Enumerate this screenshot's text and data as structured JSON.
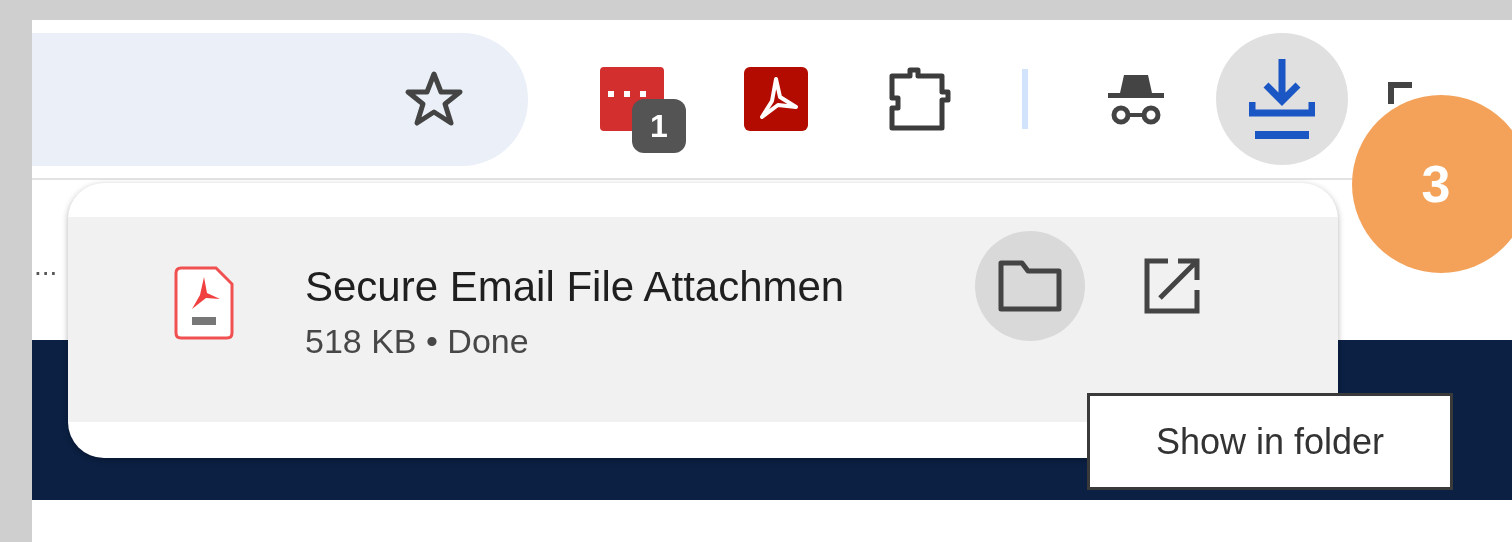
{
  "toolbar": {
    "extensions": [
      {
        "kind": "red-extension",
        "badge": "1"
      },
      {
        "kind": "acrobat"
      },
      {
        "kind": "puzzle"
      }
    ],
    "download_button": {
      "active": true
    }
  },
  "page": {
    "ellipsis": "..."
  },
  "download_popup": {
    "item": {
      "name": "Secure Email File Attachmen",
      "status": "518 KB • Done"
    },
    "actions": [
      {
        "kind": "folder",
        "hovered": true
      },
      {
        "kind": "open-external",
        "hovered": false
      }
    ]
  },
  "tooltip": "Show in folder",
  "step_badge": "3"
}
